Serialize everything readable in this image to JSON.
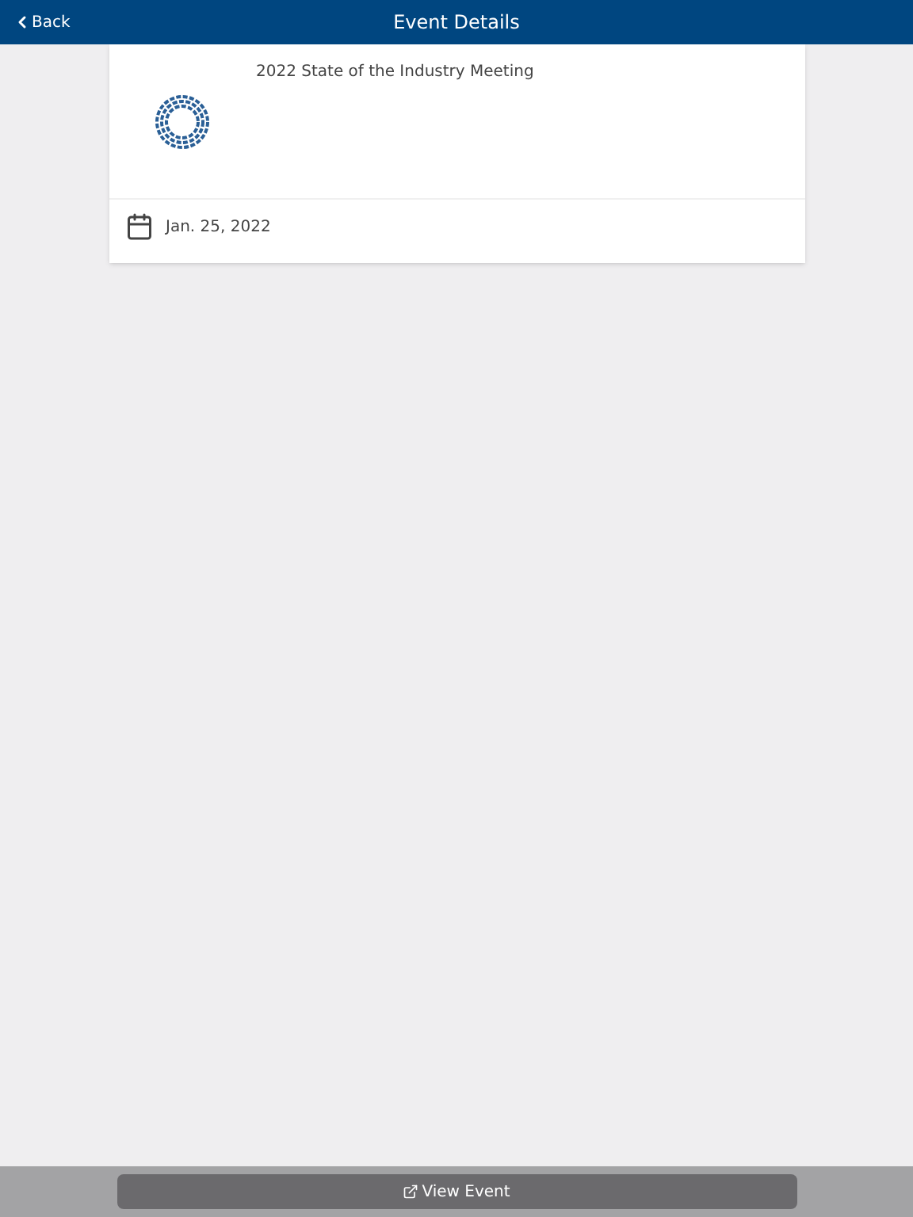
{
  "header": {
    "back": "Back",
    "title": "Event Details"
  },
  "event": {
    "title": "2022 State of the Industry Meeting",
    "date": "Jan. 25, 2022"
  },
  "footer": {
    "button": "View Event"
  }
}
